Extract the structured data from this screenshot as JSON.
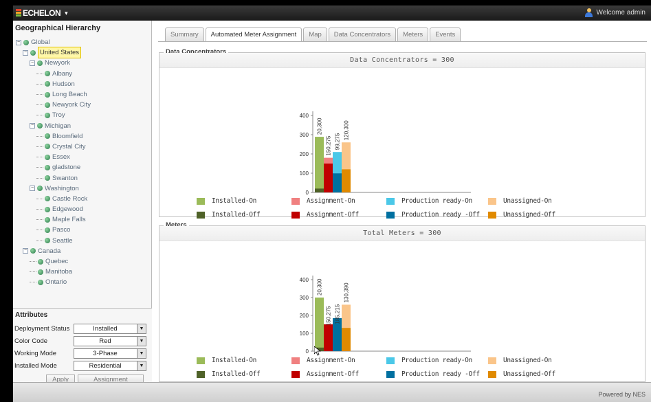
{
  "header": {
    "app_name": "ECHELON",
    "app_menu_caret": "▾",
    "welcome": "Welcome admin"
  },
  "left": {
    "panel_title": "Geographical Hierarchy",
    "tree": [
      {
        "label": "Global",
        "level": 0,
        "expander": "−"
      },
      {
        "label": "United States",
        "level": 1,
        "expander": "−",
        "selected": true
      },
      {
        "label": "Newyork",
        "level": 2,
        "expander": "−"
      },
      {
        "label": "Albany",
        "level": 3
      },
      {
        "label": "Hudson",
        "level": 3
      },
      {
        "label": "Long Beach",
        "level": 3
      },
      {
        "label": "Newyork City",
        "level": 3
      },
      {
        "label": "Troy",
        "level": 3
      },
      {
        "label": "Michigan",
        "level": 2,
        "expander": "−"
      },
      {
        "label": "Bloomfield",
        "level": 3
      },
      {
        "label": "Crystal City",
        "level": 3
      },
      {
        "label": "Essex",
        "level": 3
      },
      {
        "label": "gladstone",
        "level": 3
      },
      {
        "label": "Swanton",
        "level": 3
      },
      {
        "label": "Washington",
        "level": 2,
        "expander": "−"
      },
      {
        "label": "Castle Rock",
        "level": 3
      },
      {
        "label": "Edgewood",
        "level": 3
      },
      {
        "label": "Maple Falls",
        "level": 3
      },
      {
        "label": "Pasco",
        "level": 3
      },
      {
        "label": "Seattle",
        "level": 3
      },
      {
        "label": "Canada",
        "level": 1,
        "expander": "−"
      },
      {
        "label": "Quebec",
        "level": 2
      },
      {
        "label": "Manitoba",
        "level": 2
      },
      {
        "label": "Ontario",
        "level": 2
      }
    ],
    "attributes": {
      "title": "Attributes",
      "rows": [
        {
          "label": "Deployment Status",
          "value": "Installed"
        },
        {
          "label": "Color Code",
          "value": "Red"
        },
        {
          "label": "Working Mode",
          "value": "3-Phase"
        },
        {
          "label": "Installed Mode",
          "value": "Residential"
        }
      ],
      "apply_label": "Apply",
      "assignment_label": "Assignment"
    }
  },
  "tabs": [
    {
      "label": "Summary",
      "active": false
    },
    {
      "label": "Automated Meter Assignment",
      "active": true
    },
    {
      "label": "Map",
      "active": false
    },
    {
      "label": "Data Concentrators",
      "active": false
    },
    {
      "label": "Meters",
      "active": false
    },
    {
      "label": "Events",
      "active": false
    }
  ],
  "colors": {
    "installed_on": "#9bbb59",
    "installed_off": "#4f6228",
    "assignment_on": "#f08080",
    "assignment_off": "#c00000",
    "production_on": "#4bc8e8",
    "production_off": "#0070a0",
    "unassigned_on": "#fac58a",
    "unassigned_off": "#e08a00"
  },
  "legend_items": [
    {
      "label": "Installed-On",
      "color_key": "installed_on"
    },
    {
      "label": "Assignment-On",
      "color_key": "assignment_on"
    },
    {
      "label": "Production ready-On",
      "color_key": "production_on"
    },
    {
      "label": "Unassigned-On",
      "color_key": "unassigned_on"
    },
    {
      "label": "Installed-Off",
      "color_key": "installed_off"
    },
    {
      "label": "Assignment-Off",
      "color_key": "assignment_off"
    },
    {
      "label": "Production ready -Off",
      "color_key": "production_off"
    },
    {
      "label": "Unassigned-Off",
      "color_key": "unassigned_off"
    }
  ],
  "legend_items_meters": [
    {
      "label": "Installed-On",
      "color_key": "installed_on"
    },
    {
      "label": "Assignment-On",
      "color_key": "assignment_on"
    },
    {
      "label": "Production ready-On",
      "color_key": "production_on"
    },
    {
      "label": "Unassigned-On",
      "color_key": "unassigned_on"
    },
    {
      "label": "Installed-Off",
      "color_key": "installed_off"
    },
    {
      "label": "Assignment-Off",
      "color_key": "assignment_off"
    },
    {
      "label": "Production ready -Off",
      "color_key": "production_off"
    },
    {
      "label": "Unassigned-Off",
      "color_key": "unassigned_off"
    }
  ],
  "chart_data": [
    {
      "type": "bar",
      "section": "Data Concentrators",
      "title": "Data Concentrators = 300",
      "yticks": [
        0,
        100,
        200,
        300,
        400
      ],
      "ylim": [
        0,
        400
      ],
      "categories": [
        "Installed",
        "Assignment",
        "Production ready",
        "Unassigned"
      ],
      "series": [
        {
          "name": "On",
          "values": [
            289,
            180,
            210,
            260
          ],
          "color_keys": [
            "installed_on",
            "assignment_on",
            "production_on",
            "unassigned_on"
          ]
        },
        {
          "name": "Off",
          "values": [
            20,
            150,
            99,
            120
          ],
          "color_keys": [
            "installed_off",
            "assignment_off",
            "production_off",
            "unassigned_off"
          ]
        }
      ],
      "data_labels": [
        "20,300",
        "150,275",
        "99,275",
        "120,300"
      ]
    },
    {
      "type": "bar",
      "section": "Meters",
      "title": "Total Meters = 300",
      "yticks": [
        0,
        100,
        200,
        300,
        400
      ],
      "ylim": [
        0,
        400
      ],
      "categories": [
        "Installed",
        "Assignment",
        "Production ready",
        "Unassigned"
      ],
      "series": [
        {
          "name": "On",
          "values": [
            300,
            130,
            140,
            260
          ],
          "color_keys": [
            "installed_on",
            "assignment_on",
            "production_on",
            "unassigned_on"
          ]
        },
        {
          "name": "Off",
          "values": [
            20,
            150,
            185,
            130
          ],
          "color_keys": [
            "installed_off",
            "assignment_off",
            "production_off",
            "unassigned_off"
          ]
        }
      ],
      "data_labels": [
        "20,300",
        "150,275",
        "185,215",
        "130,390"
      ]
    }
  ],
  "footer": {
    "powered_by": "Powered by NES"
  }
}
